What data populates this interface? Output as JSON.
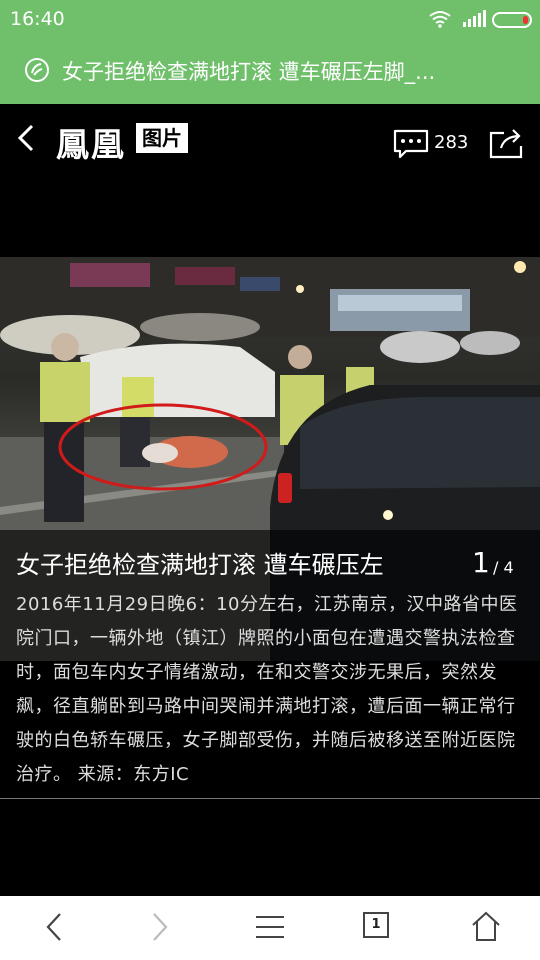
{
  "status_bar": {
    "time": "16:40"
  },
  "browser": {
    "page_title": "女子拒绝检查满地打滚 遭车碾压左脚_..."
  },
  "header": {
    "logo": "鳳凰",
    "logo_badge": "图片",
    "comment_count": "283"
  },
  "caption": {
    "title": "女子拒绝检查满地打滚 遭车碾压左",
    "page_current": "1",
    "page_total": "/ 4",
    "body": "2016年11月29日晚6：10分左右，江苏南京，汉中路省中医院门口，一辆外地（镇江）牌照的小面包在遭遇交警执法检查时，面包车内女子情绪激动，在和交警交涉无果后，突然发飙，径直躺卧到马路中间哭闹并满地打滚，遭后面一辆正常行驶的白色轿车碾压，女子脚部受伤，并随后被移送至附近医院治疗。 来源：东方IC"
  },
  "bottom_nav": {
    "tab_count": "1"
  },
  "icons": {
    "wifi": "wifi-icon",
    "signal": "signal-icon",
    "battery": "battery-icon",
    "page": "site-icon",
    "back": "back-icon",
    "comment": "comment-icon",
    "share": "share-icon",
    "nav_back": "nav-back-icon",
    "nav_forward": "nav-forward-icon",
    "menu": "menu-icon",
    "home": "home-icon"
  },
  "colors": {
    "browser_bar": "#6fbf6b",
    "circle": "#d11a1a"
  }
}
